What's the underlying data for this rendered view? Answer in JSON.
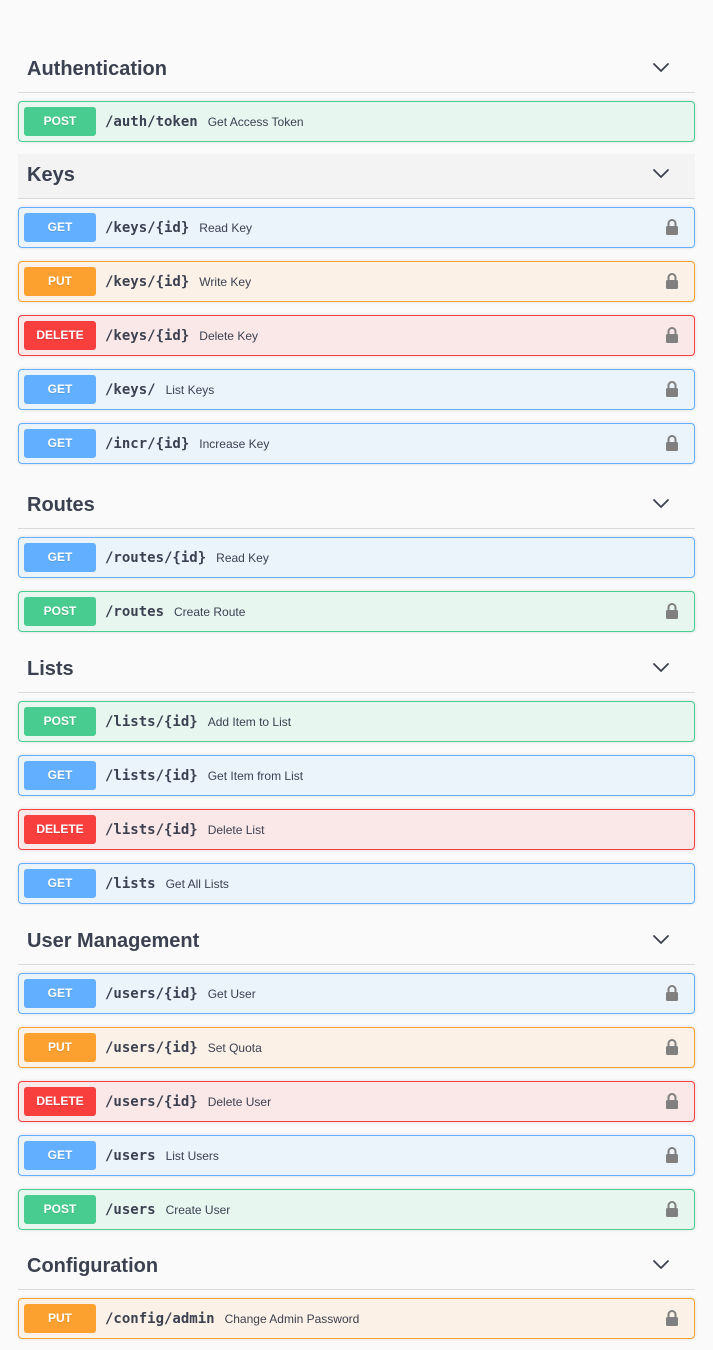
{
  "sections": [
    {
      "title": "Authentication",
      "ops": [
        {
          "method": "POST",
          "path": "/auth/token",
          "summary": "Get Access Token",
          "locked": false
        }
      ]
    },
    {
      "title": "Keys",
      "ops": [
        {
          "method": "GET",
          "path": "/keys/{id}",
          "summary": "Read Key",
          "locked": true
        },
        {
          "method": "PUT",
          "path": "/keys/{id}",
          "summary": "Write Key",
          "locked": true
        },
        {
          "method": "DELETE",
          "path": "/keys/{id}",
          "summary": "Delete Key",
          "locked": true
        },
        {
          "method": "GET",
          "path": "/keys/",
          "summary": "List Keys",
          "locked": true
        },
        {
          "method": "GET",
          "path": "/incr/{id}",
          "summary": "Increase Key",
          "locked": true
        }
      ]
    },
    {
      "title": "Routes",
      "ops": [
        {
          "method": "GET",
          "path": "/routes/{id}",
          "summary": "Read Key",
          "locked": false
        },
        {
          "method": "POST",
          "path": "/routes",
          "summary": "Create Route",
          "locked": true
        }
      ]
    },
    {
      "title": "Lists",
      "ops": [
        {
          "method": "POST",
          "path": "/lists/{id}",
          "summary": "Add Item to List",
          "locked": false
        },
        {
          "method": "GET",
          "path": "/lists/{id}",
          "summary": "Get Item from List",
          "locked": false
        },
        {
          "method": "DELETE",
          "path": "/lists/{id}",
          "summary": "Delete List",
          "locked": false
        },
        {
          "method": "GET",
          "path": "/lists",
          "summary": "Get All Lists",
          "locked": false
        }
      ]
    },
    {
      "title": "User Management",
      "ops": [
        {
          "method": "GET",
          "path": "/users/{id}",
          "summary": "Get User",
          "locked": true
        },
        {
          "method": "PUT",
          "path": "/users/{id}",
          "summary": "Set Quota",
          "locked": true
        },
        {
          "method": "DELETE",
          "path": "/users/{id}",
          "summary": "Delete User",
          "locked": true
        },
        {
          "method": "GET",
          "path": "/users",
          "summary": "List Users",
          "locked": true
        },
        {
          "method": "POST",
          "path": "/users",
          "summary": "Create User",
          "locked": true
        }
      ]
    },
    {
      "title": "Configuration",
      "ops": [
        {
          "method": "PUT",
          "path": "/config/admin",
          "summary": "Change Admin Password",
          "locked": true
        }
      ]
    }
  ],
  "icons": {
    "expand": "chevron-down-icon",
    "auth": "lock-icon"
  },
  "colors": {
    "GET": "#61affe",
    "POST": "#49cc90",
    "PUT": "#fca130",
    "DELETE": "#f93e3e",
    "text": "#3b4151"
  }
}
